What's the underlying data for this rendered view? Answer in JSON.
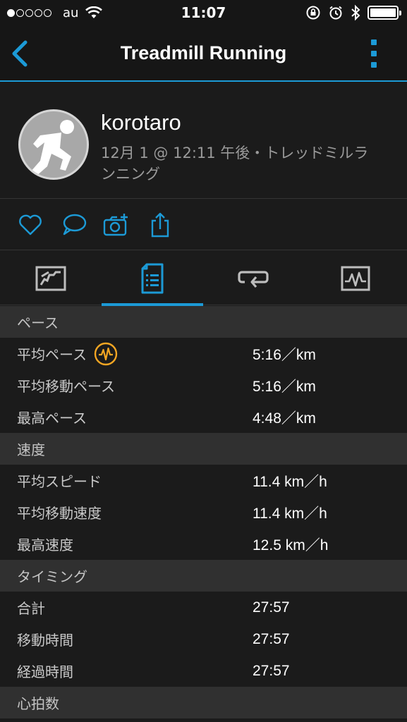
{
  "status_bar": {
    "carrier": "au",
    "time": "11:07"
  },
  "nav": {
    "title": "Treadmill Running",
    "back_icon": "chevron-left-icon",
    "menu_icon": "more-vertical-icon",
    "accent": "#1c9ad6"
  },
  "profile": {
    "user_name": "korotaro",
    "activity_meta": "12月 1 @ 12:11 午後・トレッドミルランニング"
  },
  "actions": [
    "heart-icon",
    "comment-icon",
    "camera-add-icon",
    "share-icon"
  ],
  "tabs": [
    "overview-icon",
    "details-icon",
    "laps-icon",
    "chart-icon"
  ],
  "sections": {
    "pace": {
      "header": "ペース",
      "rows": [
        {
          "label": "平均ペース",
          "value": "5:16／km"
        },
        {
          "label": "平均移動ペース",
          "value": "5:16／km"
        },
        {
          "label": "最高ペース",
          "value": "4:48／km"
        }
      ]
    },
    "speed": {
      "header": "速度",
      "rows": [
        {
          "label": "平均スピード",
          "value": "11.4 km／h"
        },
        {
          "label": "平均移動速度",
          "value": "11.4 km／h"
        },
        {
          "label": "最高速度",
          "value": "12.5 km／h"
        }
      ]
    },
    "timing": {
      "header": "タイミング",
      "rows": [
        {
          "label": "合計",
          "value": "27:57"
        },
        {
          "label": "移動時間",
          "value": "27:57"
        },
        {
          "label": "経過時間",
          "value": "27:57"
        }
      ]
    },
    "heart_rate": {
      "header": "心拍数"
    }
  }
}
